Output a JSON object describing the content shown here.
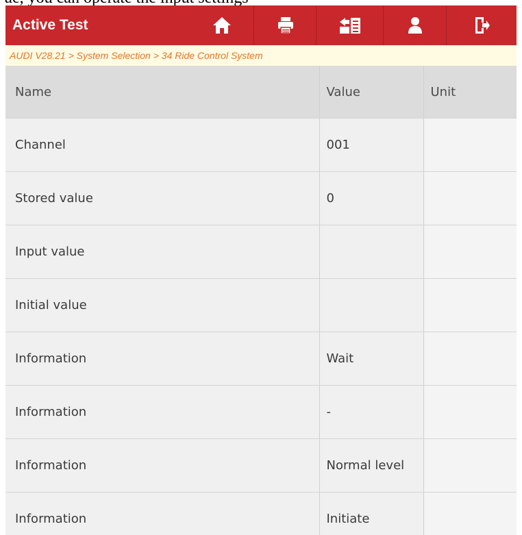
{
  "header": {
    "title": "Active Test",
    "buttons": [
      {
        "icon": "home-icon"
      },
      {
        "icon": "print-icon"
      },
      {
        "icon": "report-icon"
      },
      {
        "icon": "user-icon"
      },
      {
        "icon": "exit-icon"
      }
    ],
    "accent_color": "#c8272c"
  },
  "breadcrumb": "AUDI V28.21 > System Selection > 34 Ride Control System",
  "table": {
    "columns": [
      "Name",
      "Value",
      "Unit"
    ],
    "rows": [
      {
        "name": "Channel",
        "value": "001",
        "unit": ""
      },
      {
        "name": "Stored value",
        "value": "0",
        "unit": ""
      },
      {
        "name": "Input value",
        "value": "",
        "unit": ""
      },
      {
        "name": "Initial value",
        "value": "",
        "unit": ""
      },
      {
        "name": "Information",
        "value": "Wait",
        "unit": ""
      },
      {
        "name": "Information",
        "value": "-",
        "unit": ""
      },
      {
        "name": "Information",
        "value": "Normal level",
        "unit": ""
      },
      {
        "name": "Information",
        "value": "Initiate",
        "unit": ""
      }
    ]
  }
}
